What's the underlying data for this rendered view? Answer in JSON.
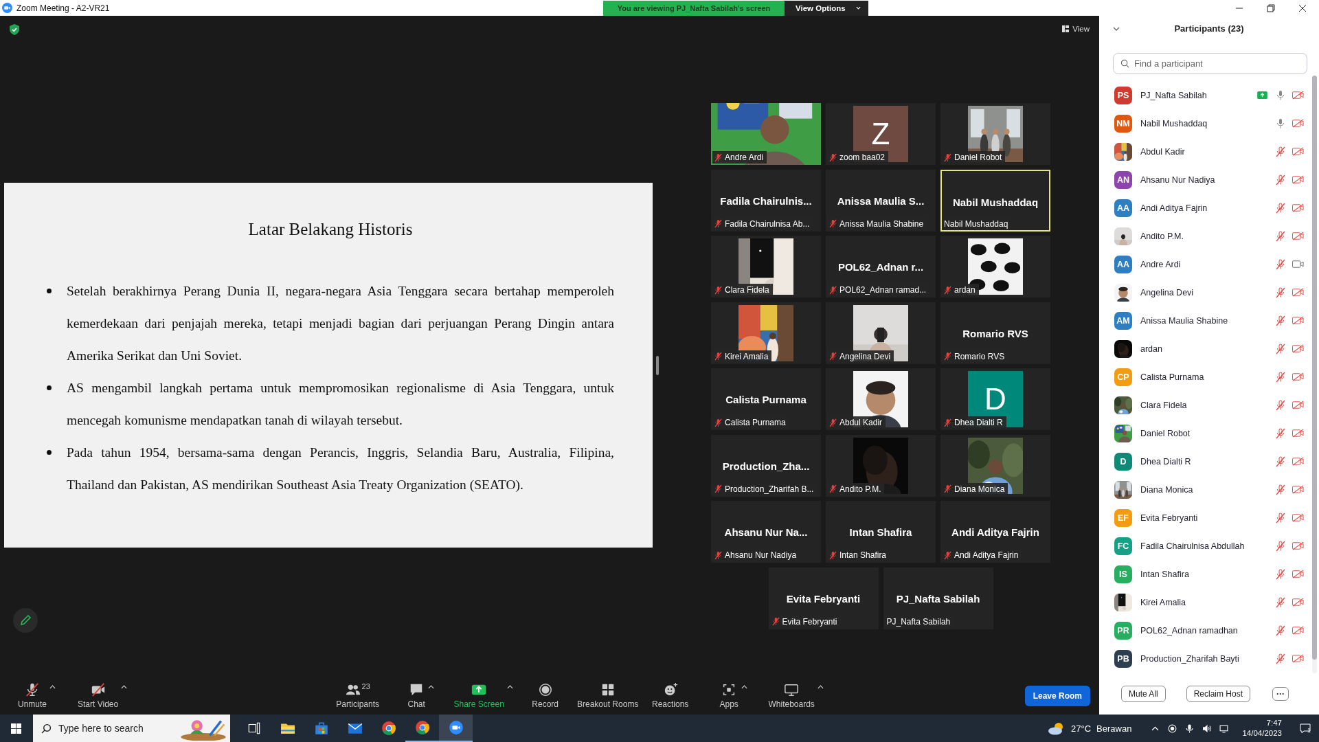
{
  "window": {
    "title": "Zoom Meeting - A2-VR21"
  },
  "banner": {
    "text": "You are viewing PJ_Nafta Sabilah's screen",
    "button": "View Options"
  },
  "view_button": "View",
  "slide": {
    "title": "Latar Belakang Historis",
    "bullets": [
      "Setelah berakhirnya Perang Dunia II, negara-negara Asia Tenggara secara bertahap memperoleh kemerdekaan dari penjajah mereka, tetapi menjadi bagian dari perjuangan Perang Dingin antara Amerika Serikat dan Uni Soviet.",
      "AS mengambil langkah pertama untuk mempromosikan regionalisme di Asia Tenggara, untuk mencegah komunisme mendapatkan tanah di wilayah tersebut.",
      "Pada tahun 1954, bersama-sama dengan Perancis, Inggris, Selandia Baru, Australia, Filipina, Thailand dan Pakistan, AS mendirikan Southeast Asia Treaty Organization (SEATO)."
    ]
  },
  "tiles": [
    {
      "kind": "wide",
      "label": "Andre Ardi",
      "muted": true,
      "speaking": false
    },
    {
      "kind": "avatar",
      "letter": "Z",
      "color": "#6e4a40",
      "label": "zoom baa02",
      "muted": true,
      "speaking": false
    },
    {
      "kind": "video",
      "label": "Daniel Robot",
      "muted": true,
      "speaking": false
    },
    {
      "kind": "name",
      "name": "Fadila Chairulnis...",
      "label": "Fadila Chairulnisa Ab...",
      "muted": true,
      "speaking": false
    },
    {
      "kind": "name",
      "name": "Anissa Maulia S...",
      "label": "Anissa Maulia Shabine",
      "muted": true,
      "speaking": false
    },
    {
      "kind": "name",
      "name": "Nabil Mushaddaq",
      "label": "Nabil Mushaddaq",
      "muted": false,
      "speaking": true
    },
    {
      "kind": "video",
      "label": "Clara Fidela",
      "muted": true,
      "speaking": false
    },
    {
      "kind": "name",
      "name": "POL62_Adnan r...",
      "label": "POL62_Adnan ramad...",
      "muted": true,
      "speaking": false
    },
    {
      "kind": "video",
      "label": "ardan",
      "muted": true,
      "speaking": false
    },
    {
      "kind": "video",
      "label": "Kirei Amalia",
      "muted": true,
      "speaking": false
    },
    {
      "kind": "video",
      "label": "Angelina Devi",
      "muted": true,
      "speaking": false
    },
    {
      "kind": "name",
      "name": "Romario RVS",
      "label": "Romario RVS",
      "muted": true,
      "speaking": false
    },
    {
      "kind": "name",
      "name": "Calista Purnama",
      "label": "Calista Purnama",
      "muted": true,
      "speaking": false
    },
    {
      "kind": "video",
      "label": "Abdul Kadir",
      "muted": true,
      "speaking": false
    },
    {
      "kind": "avatar",
      "letter": "D",
      "color": "#00897b",
      "label": "Dhea Dialti R",
      "muted": true,
      "speaking": false
    },
    {
      "kind": "name",
      "name": "Production_Zha...",
      "label": "Production_Zharifah B...",
      "muted": true,
      "speaking": false
    },
    {
      "kind": "video",
      "label": "Andito P.M.",
      "muted": true,
      "speaking": false
    },
    {
      "kind": "video",
      "label": "Diana Monica",
      "muted": true,
      "speaking": false
    },
    {
      "kind": "name",
      "name": "Ahsanu Nur Na...",
      "label": "Ahsanu Nur Nadiya",
      "muted": true,
      "speaking": false
    },
    {
      "kind": "name",
      "name": "Intan Shafira",
      "label": "Intan Shafira",
      "muted": true,
      "speaking": false
    },
    {
      "kind": "name",
      "name": "Andi Aditya Fajrin",
      "label": "Andi Aditya Fajrin",
      "muted": true,
      "speaking": false
    },
    {
      "kind": "name",
      "name": "Evita Febryanti",
      "label": "Evita Febryanti",
      "muted": true,
      "speaking": false
    },
    {
      "kind": "name",
      "name": "PJ_Nafta Sabilah",
      "label": "PJ_Nafta Sabilah",
      "muted": false,
      "speaking": false
    }
  ],
  "toolbar": {
    "items": [
      {
        "kind": "mic",
        "label": "Unmute",
        "off": true,
        "caret": true
      },
      {
        "kind": "camera",
        "label": "Start Video",
        "off": true,
        "caret": true
      },
      {
        "kind": "participants",
        "label": "Participants",
        "count": "23",
        "caret": false
      },
      {
        "kind": "chat",
        "label": "Chat",
        "caret": true
      },
      {
        "kind": "share",
        "label": "Share Screen",
        "caret": true
      },
      {
        "kind": "record",
        "label": "Record",
        "caret": false
      },
      {
        "kind": "rooms",
        "label": "Breakout Rooms",
        "caret": false
      },
      {
        "kind": "reactions",
        "label": "Reactions",
        "caret": false
      },
      {
        "kind": "apps",
        "label": "Apps",
        "caret": true
      },
      {
        "kind": "whiteboard",
        "label": "Whiteboards",
        "caret": true
      }
    ],
    "leave": "Leave Room"
  },
  "panel": {
    "title": "Participants (23)",
    "search": {
      "placeholder": "Find a participant"
    },
    "participants": [
      {
        "name": "PJ_Nafta Sabilah",
        "avatar": {
          "kind": "initials",
          "text": "PS",
          "color": "#d13b2f"
        },
        "sharing": true,
        "muted": false,
        "video_on": false
      },
      {
        "name": "Nabil Mushaddaq",
        "avatar": {
          "kind": "initials",
          "text": "NM",
          "color": "#e0570f"
        },
        "sharing": false,
        "muted": false,
        "video_on": false
      },
      {
        "name": "Abdul Kadir",
        "sharing": false,
        "muted": true,
        "video_on": false
      },
      {
        "name": "Ahsanu Nur Nadiya",
        "avatar": {
          "kind": "initials",
          "text": "AN",
          "color": "#8e44ad"
        },
        "sharing": false,
        "muted": true,
        "video_on": false
      },
      {
        "name": "Andi Aditya Fajrin",
        "avatar": {
          "kind": "initials",
          "text": "AA",
          "color": "#2d7fc1"
        },
        "sharing": false,
        "muted": true,
        "video_on": false
      },
      {
        "name": "Andito P.M.",
        "sharing": false,
        "muted": true,
        "video_on": false
      },
      {
        "name": "Andre Ardi",
        "avatar": {
          "kind": "initials",
          "text": "AA",
          "color": "#2d7fc1"
        },
        "sharing": false,
        "muted": true,
        "video_on": true
      },
      {
        "name": "Angelina Devi",
        "sharing": false,
        "muted": true,
        "video_on": false
      },
      {
        "name": "Anissa Maulia Shabine",
        "avatar": {
          "kind": "initials",
          "text": "AM",
          "color": "#2d7fc1"
        },
        "sharing": false,
        "muted": true,
        "video_on": false
      },
      {
        "name": "ardan",
        "sharing": false,
        "muted": true,
        "video_on": false
      },
      {
        "name": "Calista Purnama",
        "avatar": {
          "kind": "initials",
          "text": "CP",
          "color": "#f39c12"
        },
        "sharing": false,
        "muted": true,
        "video_on": false
      },
      {
        "name": "Clara Fidela",
        "sharing": false,
        "muted": true,
        "video_on": false
      },
      {
        "name": "Daniel Robot",
        "sharing": false,
        "muted": true,
        "video_on": false
      },
      {
        "name": "Dhea Dialti R",
        "avatar": {
          "kind": "initials",
          "text": "D",
          "color": "#0e8a76"
        },
        "sharing": false,
        "muted": true,
        "video_on": false
      },
      {
        "name": "Diana Monica",
        "sharing": false,
        "muted": true,
        "video_on": false
      },
      {
        "name": "Evita Febryanti",
        "avatar": {
          "kind": "initials",
          "text": "EF",
          "color": "#f39c12"
        },
        "sharing": false,
        "muted": true,
        "video_on": false
      },
      {
        "name": "Fadila Chairulnisa Abdullah",
        "avatar": {
          "kind": "initials",
          "text": "FC",
          "color": "#16a085"
        },
        "sharing": false,
        "muted": true,
        "video_on": false
      },
      {
        "name": "Intan Shafira",
        "avatar": {
          "kind": "initials",
          "text": "IS",
          "color": "#27ae60"
        },
        "sharing": false,
        "muted": true,
        "video_on": false
      },
      {
        "name": "Kirei Amalia",
        "sharing": false,
        "muted": true,
        "video_on": false
      },
      {
        "name": "POL62_Adnan ramadhan",
        "avatar": {
          "kind": "initials",
          "text": "PR",
          "color": "#27ae60"
        },
        "sharing": false,
        "muted": true,
        "video_on": false
      },
      {
        "name": "Production_Zharifah Bayti",
        "avatar": {
          "kind": "initials",
          "text": "PB",
          "color": "#2c3e50"
        },
        "sharing": false,
        "muted": true,
        "video_on": false
      }
    ],
    "buttons": [
      "Mute All",
      "Reclaim Host"
    ],
    "more": "···"
  },
  "taskbar": {
    "search": {
      "placeholder": "Type here to search"
    },
    "apps": [
      {
        "kind": "taskview",
        "running": false,
        "active": false
      },
      {
        "kind": "explorer",
        "running": false,
        "active": false
      },
      {
        "kind": "store",
        "running": false,
        "active": false
      },
      {
        "kind": "mail",
        "running": false,
        "active": false
      },
      {
        "kind": "chrome",
        "running": false,
        "active": false
      },
      {
        "kind": "chrome",
        "running": true,
        "active": false
      },
      {
        "kind": "zoom",
        "running": true,
        "active": true
      }
    ],
    "weather": {
      "temp": "27°C",
      "text": "Berawan"
    },
    "clock": {
      "time": "7:47",
      "date": "14/04/2023"
    },
    "notifications": "1"
  }
}
